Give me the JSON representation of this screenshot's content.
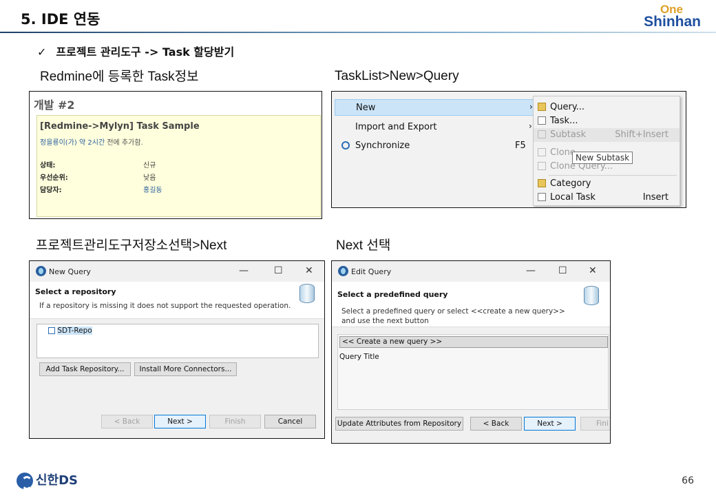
{
  "header": {
    "title": "5. IDE 연동",
    "logo_top": "One",
    "logo_bottom": "Shinhan"
  },
  "bullet": {
    "check": "✓",
    "text": "프로젝트 관리도구 -> Task 할당받기"
  },
  "captions": {
    "c1": "Redmine에 등록한 Task정보",
    "c2": "TaskList>New>Query",
    "c3": "프로젝트관리도구저장소선택>Next",
    "c4": "Next 선택"
  },
  "redmine": {
    "title": "개발 #2",
    "subject": "[Redmine->Mylyn] Task Sample",
    "meta_author": "정을룡이(가)",
    "meta_time": "약 2시간",
    "meta_rest": "전에 추가함.",
    "rows": [
      {
        "label": "상태:",
        "value": "신규"
      },
      {
        "label": "우선순위:",
        "value": "낮음"
      },
      {
        "label": "담당자:",
        "value": "홍길동"
      }
    ]
  },
  "context_menu": {
    "items": [
      {
        "label": "New",
        "arrow": "›"
      },
      {
        "label": "Import and Export",
        "arrow": "›"
      },
      {
        "label": "Synchronize",
        "shortcut": "F5"
      }
    ],
    "submenu": [
      {
        "label": "Query...",
        "shortcut": ""
      },
      {
        "label": "Task...",
        "shortcut": ""
      },
      {
        "label": "Subtask",
        "shortcut": "Shift+Insert"
      },
      {
        "label": "Clone",
        "shortcut": ""
      },
      {
        "label": "Clone Query...",
        "shortcut": ""
      },
      {
        "label": "Category",
        "shortcut": ""
      },
      {
        "label": "Local Task",
        "shortcut": "Insert"
      }
    ],
    "tooltip": "New Subtask"
  },
  "new_query": {
    "title": "New Query",
    "heading": "Select a repository",
    "description": "If a repository is missing it does not support the requested operation.",
    "repo_item": "SDT-Repo",
    "add_repo": "Add Task Repository...",
    "install_connectors": "Install More Connectors...",
    "back": "< Back",
    "next": "Next >",
    "finish": "Finish",
    "cancel": "Cancel"
  },
  "edit_query": {
    "title": "Edit Query",
    "heading": "Select a predefined query",
    "description_1": "Select a predefined query or select <<create a new query>>",
    "description_2": "and use the next button",
    "selected_item": "<< Create a new query >>",
    "column_title": "Query Title",
    "update_button": "Update Attributes from Repository",
    "back": "< Back",
    "next": "Next >",
    "finish": "Fini"
  },
  "window_controls": {
    "minimize": "—",
    "maximize": "☐",
    "close": "✕"
  },
  "footer": {
    "brand": "신한DS",
    "page_number": "66"
  }
}
